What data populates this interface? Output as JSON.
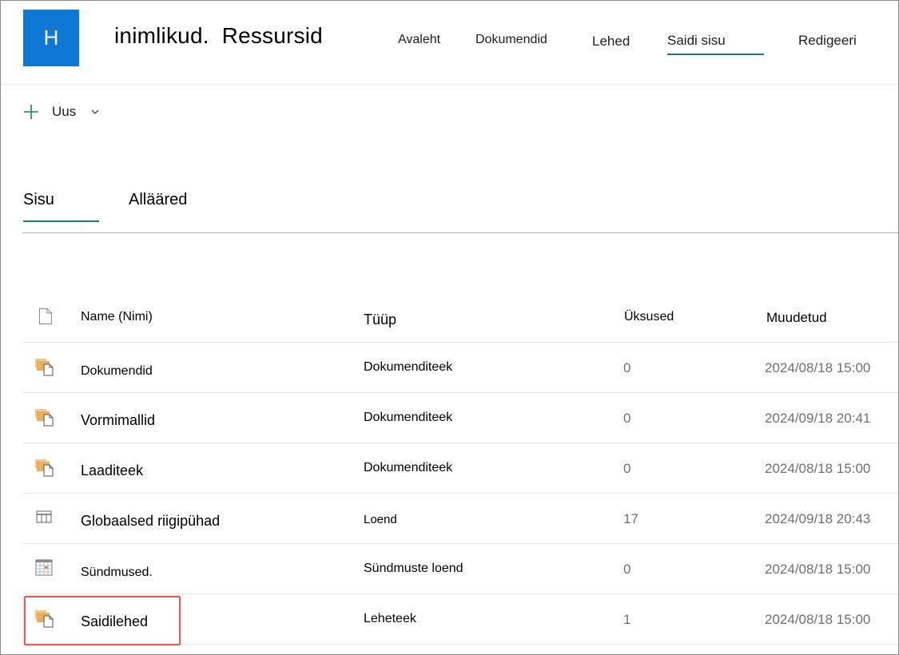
{
  "header": {
    "logo_letter": "H",
    "site_title": "inimlikud.  Ressursid",
    "nav": [
      {
        "label": "Avaleht"
      },
      {
        "label": "Dokumendid"
      },
      {
        "label": "Lehed"
      },
      {
        "label": "Saidi sisu",
        "active": true
      },
      {
        "label": "Redigeeri"
      }
    ],
    "accent_color": "#1c7c7c",
    "logo_color": "#0f78d4"
  },
  "command_bar": {
    "new_label": "Uus",
    "new_icon": "plus-icon",
    "dropdown_icon": "chevron-down-icon"
  },
  "tabs": [
    {
      "label": "Sisu",
      "active": true
    },
    {
      "label": "Allääred"
    }
  ],
  "table": {
    "columns": {
      "icon": "file-icon",
      "name": "Name (Nimi)",
      "type": "Tüüp",
      "items": "Üksused",
      "modified": "Muudetud"
    },
    "rows": [
      {
        "icon": "library-icon",
        "name": "Dokumendid",
        "type": "Dokumenditeek",
        "items": "0",
        "modified": "2024/08/18 15:00"
      },
      {
        "icon": "library-icon",
        "name": "Vormimallid",
        "type": "Dokumenditeek",
        "items": "0",
        "modified": "2024/09/18 20:41"
      },
      {
        "icon": "library-icon",
        "name": "Laaditeek",
        "type": "Dokumenditeek",
        "items": "0",
        "modified": "2024/08/18 15:00"
      },
      {
        "icon": "list-icon",
        "name": "Globaalsed riigipühad",
        "type": "Loend",
        "items": "17",
        "modified": "2024/09/18 20:43"
      },
      {
        "icon": "calendar-icon",
        "name": "Sündmused.",
        "type": "Sündmuste loend",
        "items": "0",
        "modified": "2024/08/18 15:00"
      },
      {
        "icon": "library-icon",
        "name": "Saidilehed",
        "type": "Leheteek",
        "items": "1",
        "modified": "2024/08/18 15:00",
        "highlighted": true
      }
    ]
  },
  "highlight_color": "#e25b5b"
}
